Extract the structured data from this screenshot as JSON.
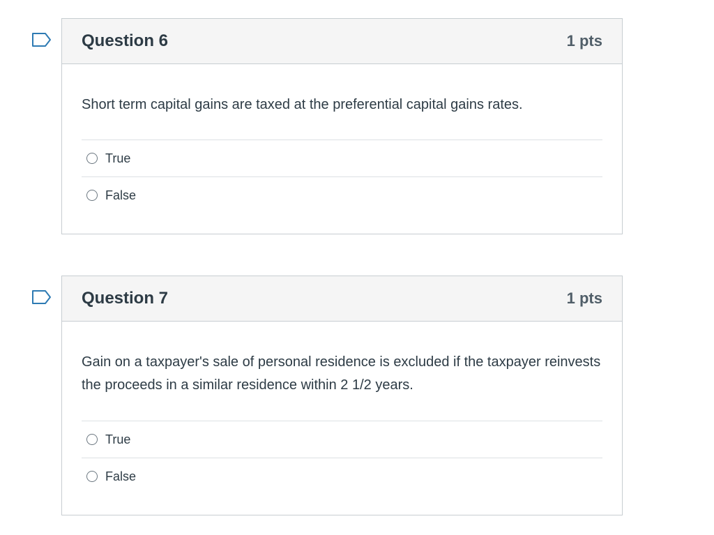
{
  "questions": [
    {
      "title": "Question 6",
      "points": "1 pts",
      "text": "Short term capital gains are taxed at the preferential capital gains rates.",
      "answers": [
        {
          "label": "True",
          "selected": false
        },
        {
          "label": "False",
          "selected": false
        }
      ],
      "flag_icon": "flag-question-icon"
    },
    {
      "title": "Question 7",
      "points": "1 pts",
      "text": "Gain on a taxpayer's sale of personal residence is excluded if the taxpayer reinvests the proceeds in a similar residence within 2 1/2 years.",
      "answers": [
        {
          "label": "True",
          "selected": false
        },
        {
          "label": "False",
          "selected": false
        }
      ],
      "flag_icon": "flag-question-icon"
    }
  ],
  "colors": {
    "flag_stroke": "#2d7ab3",
    "header_bg": "#f5f5f5",
    "border": "#c7cdd1"
  }
}
